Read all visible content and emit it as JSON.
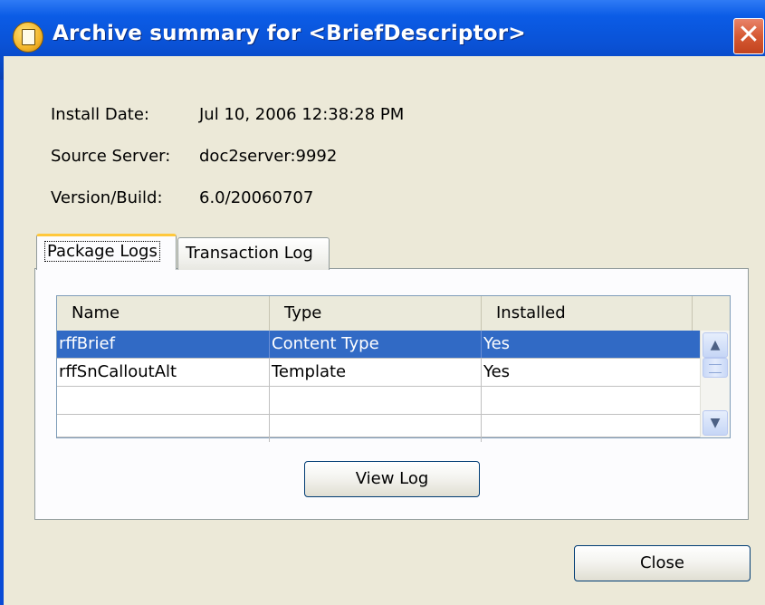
{
  "window": {
    "title": "Archive summary for <BriefDescriptor>",
    "close_glyph": "✕"
  },
  "info": {
    "install_date_label": "Install Date:",
    "install_date_value": "Jul 10, 2006 12:38:28 PM",
    "source_server_label": "Source Server:",
    "source_server_value": "doc2server:9992",
    "version_label": "Version/Build:",
    "version_value": "6.0/20060707"
  },
  "tabs": [
    {
      "label": "Package Logs",
      "active": true
    },
    {
      "label": "Transaction Log",
      "active": false
    }
  ],
  "table": {
    "columns": [
      "Name",
      "Type",
      "Installed"
    ],
    "rows": [
      {
        "name": "rffBrief",
        "type": "Content Type",
        "installed": "Yes",
        "selected": true
      },
      {
        "name": "rffSnCalloutAlt",
        "type": "Template",
        "installed": "Yes",
        "selected": false
      },
      {
        "name": "",
        "type": "",
        "installed": "",
        "selected": false
      },
      {
        "name": "",
        "type": "",
        "installed": "",
        "selected": false
      }
    ]
  },
  "buttons": {
    "view_log": "View Log",
    "close": "Close"
  },
  "icons": {
    "scroll_up": "▲",
    "scroll_down": "▼"
  },
  "colors": {
    "titlebar": "#0a52d6",
    "selection": "#316ac5",
    "dialog_bg": "#ece9d8",
    "close_button": "#d65a34"
  }
}
